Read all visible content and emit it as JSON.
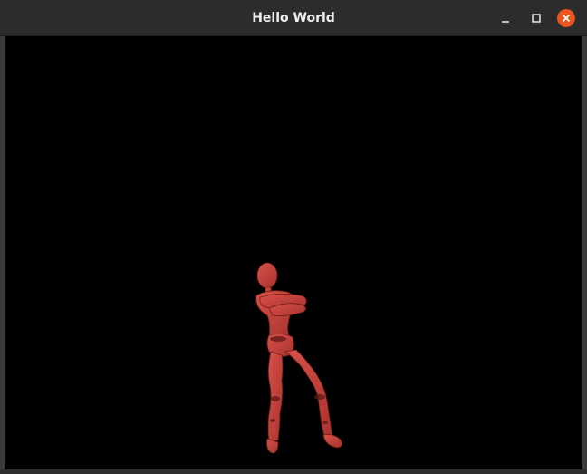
{
  "window": {
    "title": "Hello World"
  },
  "controls": {
    "minimize_icon": "minimize-icon",
    "maximize_icon": "maximize-icon",
    "close_icon": "close-icon",
    "close_color": "#e9541f"
  },
  "viewport": {
    "background": "#000000",
    "model_color": "#c9443d"
  }
}
